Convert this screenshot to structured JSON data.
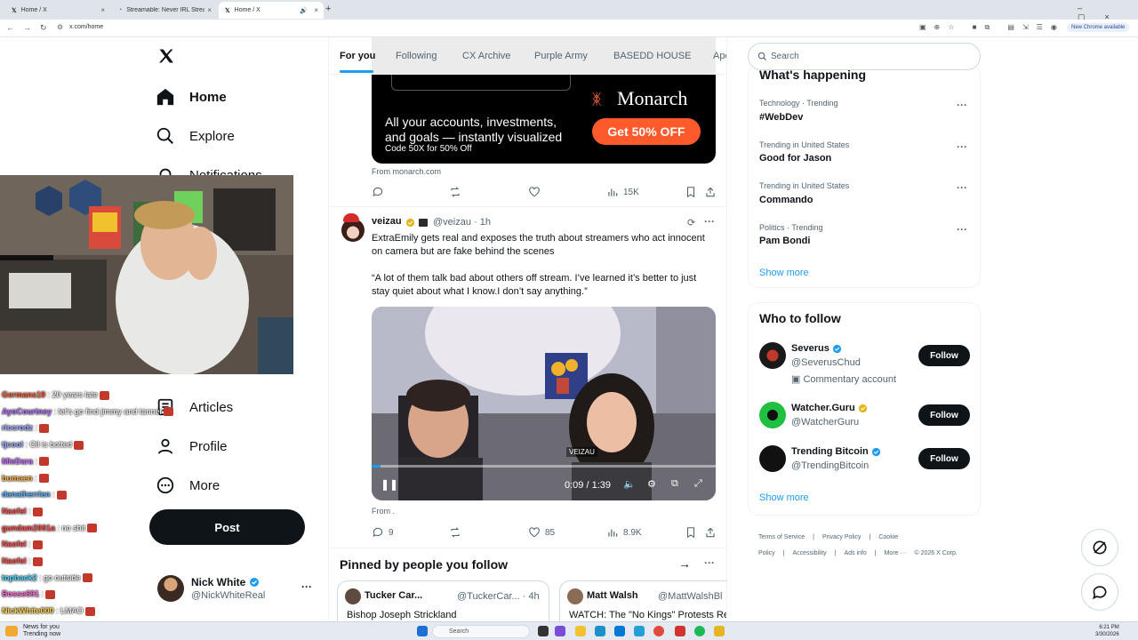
{
  "browser": {
    "tabs": [
      {
        "title": "Home / X",
        "active": false
      },
      {
        "title": "Streamable: Never IRL Stream ...",
        "active": false
      },
      {
        "title": "Home / X",
        "active": true
      }
    ],
    "url": "x.com/home",
    "new_chrome": "New Chrome available"
  },
  "nav": {
    "items": [
      {
        "label": "Home",
        "icon": "home-icon"
      },
      {
        "label": "Explore",
        "icon": "search-icon"
      },
      {
        "label": "Notifications",
        "icon": "bell-icon"
      },
      {
        "label": "Articles",
        "icon": "article-icon"
      },
      {
        "label": "Profile",
        "icon": "person-icon"
      },
      {
        "label": "More",
        "icon": "more-circle-icon"
      }
    ],
    "post_label": "Post",
    "profile": {
      "name": "Nick White",
      "handle": "@NickWhiteReal"
    }
  },
  "chat": [
    {
      "user": "Germans19",
      "text": ": 20 years late",
      "color": "#ff5c3a"
    },
    {
      "user": "AyoCourtney",
      "text": ": let's go find jimmy and tanner",
      "color": "#b56cff"
    },
    {
      "user": "riccrodz",
      "text": ":",
      "color": "#9aa7ff"
    },
    {
      "user": "tjcool",
      "text": ": Oil is botted",
      "color": "#9aa7ff"
    },
    {
      "user": "MieDara",
      "text": ":",
      "color": "#c96bff"
    },
    {
      "user": "bumaen",
      "text": ":",
      "color": "#ffb347"
    },
    {
      "user": "danatherrien",
      "text": ":",
      "color": "#5ab0ff"
    },
    {
      "user": "Naofel",
      "text": ":",
      "color": "#ff4d4d"
    },
    {
      "user": "gundam2001a",
      "text": ": no shit",
      "color": "#ff4d4d"
    },
    {
      "user": "Naofel",
      "text": ":",
      "color": "#ff4d4d"
    },
    {
      "user": "Naofel",
      "text": ":",
      "color": "#ff4d4d"
    },
    {
      "user": "topback2",
      "text": ": go outside",
      "color": "#4dd6ff"
    },
    {
      "user": "Bosse691",
      "text": ":",
      "color": "#ff6ad5"
    },
    {
      "user": "NickWhite000",
      "text": ": LMAO",
      "color": "#ffd24d"
    }
  ],
  "feed": {
    "tabs": [
      "For you",
      "Following",
      "CX Archive",
      "Purple Army",
      "BASEDD HOUSE",
      "Ape"
    ],
    "ad": {
      "brand": "Monarch",
      "line1": "All your accounts, investments,",
      "line2": "and goals — instantly visualized",
      "code": "Code 50X for 50% Off",
      "cta": "Get 50% OFF",
      "source": "From monarch.com",
      "views": "15K"
    },
    "tweet": {
      "name": "veizau",
      "handle": "@veizau · 1h",
      "text1": "ExtraEmily gets real and exposes the truth about streamers who act innocent on camera but are fake behind the scenes",
      "text2": "“A lot of them talk bad about others off stream. I’ve learned it’s better to just stay quiet about what I know.I don’t say anything.”",
      "video_time": "0:09 / 1:39",
      "watermark": "VEIZAU",
      "from": "From .",
      "replies": "9",
      "likes": "85",
      "views": "8.9K"
    },
    "pinned_title": "Pinned by people you follow",
    "pinned": [
      {
        "name": "Tucker Car...",
        "handle": "@TuckerCar... · 4h",
        "text": "Bishop Joseph Strickland"
      },
      {
        "name": "Matt Walsh",
        "handle": "@MattWalshBl",
        "text": "WATCH: The \"No Kings\" Protests Re"
      }
    ]
  },
  "right": {
    "search_placeholder": "Search",
    "happening_title": "What's happening",
    "trends": [
      {
        "meta": "Technology · Trending",
        "name": "#WebDev"
      },
      {
        "meta": "Trending in United States",
        "name": "Good for Jason"
      },
      {
        "meta": "Trending in United States",
        "name": "Commando"
      },
      {
        "meta": "Politics · Trending",
        "name": "Pam Bondi"
      }
    ],
    "show_more": "Show more",
    "who_title": "Who to follow",
    "follow": [
      {
        "name": "Severus",
        "handle": "@SeverusChud",
        "extra": "Commentary account",
        "badge": "#1d9bf0"
      },
      {
        "name": "Watcher.Guru",
        "handle": "@WatcherGuru",
        "extra": "",
        "badge": "#e2b719"
      },
      {
        "name": "Trending Bitcoin",
        "handle": "@TrendingBitcoin",
        "extra": "",
        "badge": "#1d9bf0"
      }
    ],
    "follow_label": "Follow",
    "footer": [
      "Terms of Service",
      "|",
      "Privacy Policy",
      "|",
      "Cookie Policy",
      "|",
      "Accessibility",
      "|",
      "Ads info",
      "|",
      "More ···",
      "© 2026 X Corp."
    ]
  },
  "taskbar": {
    "news_line1": "News for you",
    "news_line2": "Trending now",
    "search": "Search",
    "time": "6:21 PM",
    "date": "3/30/2026"
  }
}
